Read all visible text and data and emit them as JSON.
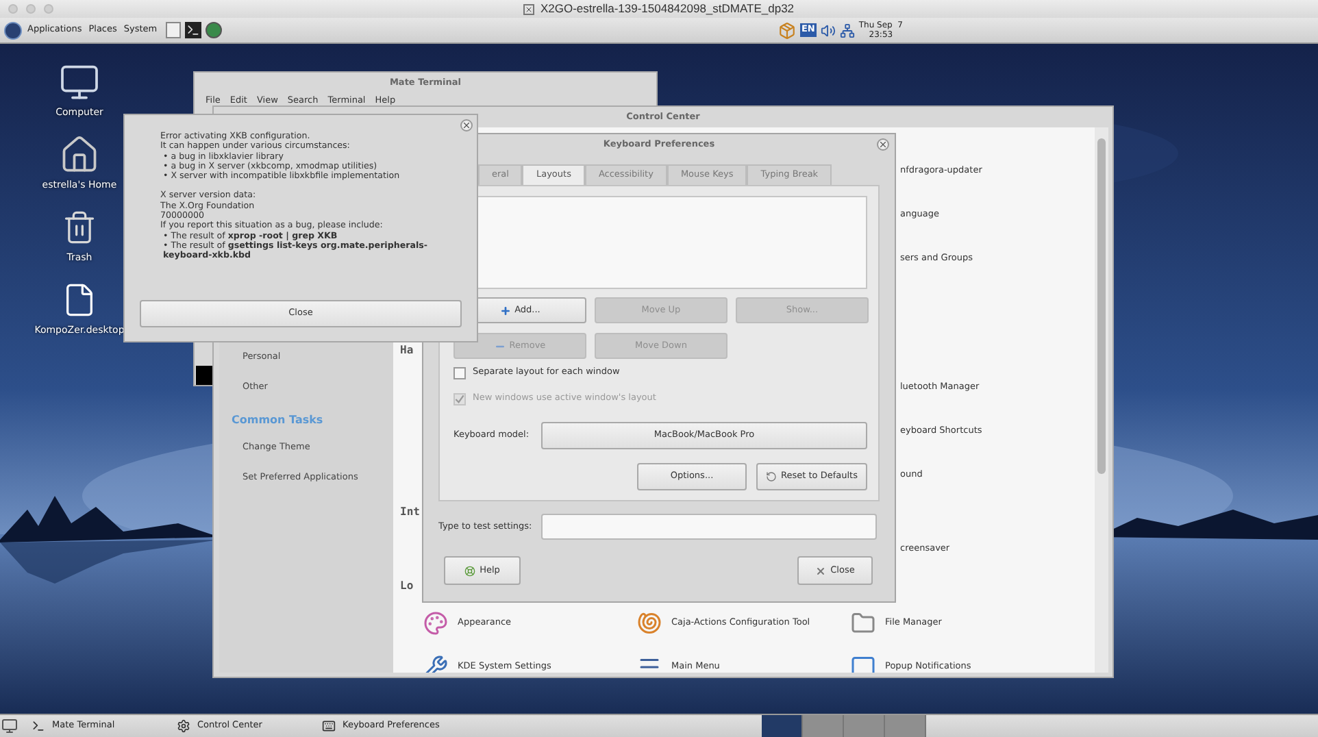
{
  "host_window": {
    "title": "X2GO-estrella-139-1504842098_stDMATE_dp32"
  },
  "top_panel": {
    "menus": [
      "Applications",
      "Places",
      "System"
    ],
    "keyboard_layout": "EN",
    "clock": {
      "day": "Thu Sep  7",
      "time": "23:53"
    }
  },
  "desktop_icons": [
    {
      "label": "Computer",
      "kind": "computer"
    },
    {
      "label": "estrella's Home",
      "kind": "home"
    },
    {
      "label": "Trash",
      "kind": "trash"
    },
    {
      "label": "KompoZer.desktop",
      "kind": "file"
    }
  ],
  "terminal_window": {
    "title": "Mate Terminal",
    "menu": [
      "File",
      "Edit",
      "View",
      "Search",
      "Terminal",
      "Help"
    ]
  },
  "control_center": {
    "title": "Control Center",
    "sidebar": {
      "items": [
        "Personal",
        "Other"
      ],
      "common_tasks": {
        "heading": "Common Tasks",
        "items": [
          "Change Theme",
          "Set Preferred Applications"
        ]
      }
    },
    "sections": [
      {
        "kind": "covered",
        "items": [
          "nfdragora-updater",
          "anguage",
          "sers and Groups"
        ]
      },
      {
        "kind": "covered",
        "heading": "Ha",
        "items": [
          "luetooth Manager",
          "eyboard Shortcuts",
          "ound"
        ]
      },
      {
        "kind": "covered",
        "heading": "Int",
        "items": [
          "creensaver"
        ]
      },
      {
        "kind": "open",
        "heading": "Lo",
        "items": [
          "Appearance",
          "Caja-Actions Configuration Tool",
          "File Manager",
          "KDE System Settings",
          "Main Menu",
          "Popup Notifications"
        ]
      }
    ]
  },
  "keyboard_preferences": {
    "title": "Keyboard Preferences",
    "tabs": [
      {
        "label": "eral",
        "selected": false
      },
      {
        "label": "Layouts",
        "selected": true
      },
      {
        "label": "Accessibility",
        "selected": false
      },
      {
        "label": "Mouse Keys",
        "selected": false
      },
      {
        "label": "Typing Break",
        "selected": false
      }
    ],
    "layout_buttons": [
      {
        "label": "Add...",
        "kind": "add",
        "disabled": false
      },
      {
        "label": "Move Up",
        "kind": "plain",
        "disabled": true
      },
      {
        "label": "Show...",
        "kind": "plain",
        "disabled": true
      },
      {
        "label": "Remove",
        "kind": "remove",
        "disabled": true
      },
      {
        "label": "Move Down",
        "kind": "plain",
        "disabled": true
      }
    ],
    "options": [
      {
        "label": "Separate layout for each window",
        "checked": false,
        "disabled": false
      },
      {
        "label": "New windows use active window's layout",
        "checked": true,
        "disabled": true
      }
    ],
    "keyboard_model": {
      "label": "Keyboard model:",
      "value": "MacBook/MacBook Pro"
    },
    "options_button": "Options...",
    "reset_button": "Reset to Defaults",
    "test_field": {
      "label": "Type to test settings:"
    },
    "help_button": "Help",
    "close_button": "Close"
  },
  "error_dialog": {
    "paragraphs": [
      [
        {
          "text": "Error activating XKB configuration.",
          "kind": "plain"
        },
        {
          "text": "It can happen under various circumstances:",
          "kind": "plain"
        },
        {
          "text": "• a bug in libxklavier library",
          "kind": "bullet"
        },
        {
          "text": "• a bug in X server (xkbcomp, xmodmap utilities)",
          "kind": "bullet"
        },
        {
          "text": "• X server with incompatible libxkbfile implementation",
          "kind": "bullet"
        }
      ],
      [
        {
          "text": "X server version data:",
          "kind": "plain"
        },
        {
          "text": "The X.Org Foundation",
          "kind": "plain"
        },
        {
          "text": "70000000",
          "kind": "plain"
        },
        {
          "text": "If you report this situation as a bug, please include:",
          "kind": "plain"
        },
        {
          "text": "• The result of **xprop -root | grep XKB**",
          "kind": "bullet"
        },
        {
          "text": "• The result of **gsettings list-keys org.mate.peripherals-keyboard-xkb.kbd**",
          "kind": "bullet-wrap"
        }
      ]
    ],
    "button": "Close"
  },
  "taskbar": {
    "tasks": [
      {
        "label": "Mate Terminal",
        "kind": "terminal"
      },
      {
        "label": "Control Center",
        "kind": "control"
      },
      {
        "label": "Keyboard Preferences",
        "kind": "keyboard"
      }
    ],
    "workspaces": [
      {
        "selected": true
      },
      {
        "selected": false
      },
      {
        "selected": false
      },
      {
        "selected": false
      }
    ]
  }
}
